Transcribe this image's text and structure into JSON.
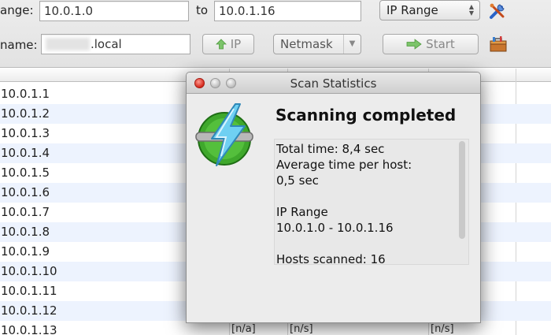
{
  "toolbar": {
    "range_label": "ange:",
    "ip_start": "10.0.1.0",
    "to_label": "to",
    "ip_end": "10.0.1.16",
    "feeder_select": "IP Range",
    "hostname_label": "name:",
    "hostname_suffix": ".local",
    "ip_button": "IP",
    "netmask_select": "Netmask",
    "start_button": "Start",
    "icons": [
      "tools-icon",
      "toolbox-icon",
      "arrow-up-icon",
      "arrow-right-icon"
    ]
  },
  "results": {
    "rows": [
      "10.0.1.1",
      "10.0.1.2",
      "10.0.1.3",
      "10.0.1.4",
      "10.0.1.5",
      "10.0.1.6",
      "10.0.1.7",
      "10.0.1.8",
      "10.0.1.9",
      "10.0.1.10",
      "10.0.1.11",
      "10.0.1.12",
      "10.0.1.13"
    ],
    "last_row_cells": [
      "[n/a]",
      "[n/s]",
      "[n/s]"
    ]
  },
  "dialog": {
    "title": "Scan Statistics",
    "heading": "Scanning completed",
    "total_time": "Total time: 8,4 sec",
    "avg_label": "Average time per host:",
    "avg_value": "0,5 sec",
    "range_label": "IP Range",
    "range_value": "10.0.1.0 - 10.0.1.16",
    "hosts_scanned": "Hosts scanned: 16",
    "logo_icon": "angry-ip-scanner-logo-icon"
  },
  "colors": {
    "row_alt": "#edf3fe",
    "close_button": "#d4281c",
    "logo_green": "#3fa82c",
    "logo_bolt": "#5cc8ee"
  }
}
